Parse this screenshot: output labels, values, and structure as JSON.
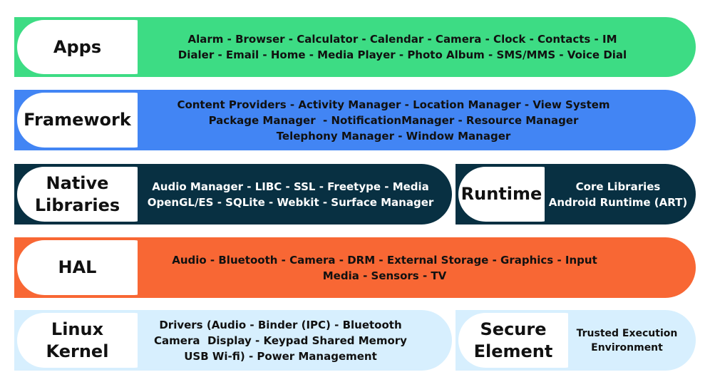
{
  "colors": {
    "apps": "#3ddc84",
    "framework": "#4285f4",
    "native": "#083042",
    "hal": "#f86734",
    "kernel": "#d7effe"
  },
  "layers": {
    "apps": {
      "label": "Apps",
      "lines": [
        "Alarm - Browser - Calculator - Calendar - Camera - Clock - Contacts - IM",
        "Dialer - Email - Home - Media Player - Photo Album - SMS/MMS - Voice Dial"
      ]
    },
    "framework": {
      "label": "Framework",
      "lines": [
        "Content Providers - Activity Manager - Location Manager - View System",
        "Package Manager  - NotificationManager - Resource Manager",
        "Telephony Manager - Window Manager"
      ]
    },
    "native": {
      "label": "Native Libraries",
      "lines": [
        "Audio Manager - LIBC - SSL - Freetype - Media",
        "OpenGL/ES - SQLite - Webkit - Surface Manager"
      ]
    },
    "runtime": {
      "label": "Runtime",
      "lines": [
        "Core Libraries",
        "Android Runtime (ART)"
      ]
    },
    "hal": {
      "label": "HAL",
      "lines": [
        "Audio - Bluetooth - Camera - DRM - External Storage - Graphics - Input",
        "Media - Sensors - TV"
      ]
    },
    "kernel": {
      "label": "Linux Kernel",
      "lines": [
        "Drivers (Audio - Binder (IPC) - Bluetooth",
        "Camera  Display - Keypad Shared Memory",
        "USB Wi-fi) - Power Management"
      ]
    },
    "secure": {
      "label": "Secure Element",
      "lines": [
        "Trusted Execution",
        "Environment"
      ]
    }
  }
}
